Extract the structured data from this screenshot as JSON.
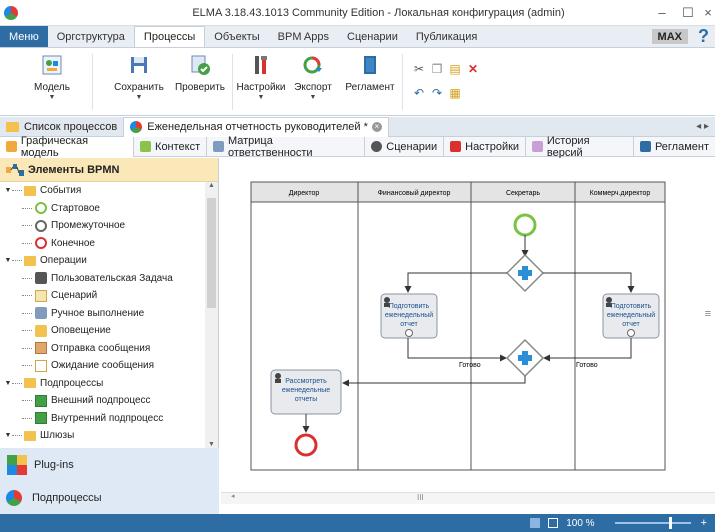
{
  "window": {
    "title": "ELMA 3.18.43.1013 Community Edition - Локальная конфигурация (admin)"
  },
  "menu": {
    "items": [
      "Меню",
      "Оргструктура",
      "Процессы",
      "Объекты",
      "BPM Apps",
      "Сценарии",
      "Публикация"
    ],
    "max_label": "MAX",
    "help": "?"
  },
  "ribbon": {
    "model": "Модель",
    "save": "Сохранить",
    "check": "Проверить",
    "settings": "Настройки",
    "export": "Экспорт",
    "reglament": "Регламент"
  },
  "doc_tabs": {
    "list": "Список процессов",
    "current": "Еженедельная отчетность руководителей *"
  },
  "sub_tabs": [
    "Графическая модель",
    "Контекст",
    "Матрица ответственности",
    "Сценарии",
    "Настройки",
    "История версий",
    "Регламент"
  ],
  "panel": {
    "title": "Элементы BPMN",
    "tree": [
      {
        "label": "События",
        "level": 0,
        "type": "folder"
      },
      {
        "label": "Стартовое",
        "level": 1,
        "type": "start"
      },
      {
        "label": "Промежуточное",
        "level": 1,
        "type": "intermediate"
      },
      {
        "label": "Конечное",
        "level": 1,
        "type": "end"
      },
      {
        "label": "Операции",
        "level": 0,
        "type": "folder"
      },
      {
        "label": "Пользовательская Задача",
        "level": 1,
        "type": "user"
      },
      {
        "label": "Сценарий",
        "level": 1,
        "type": "script"
      },
      {
        "label": "Ручное выполнение",
        "level": 1,
        "type": "manual"
      },
      {
        "label": "Оповещение",
        "level": 1,
        "type": "notify"
      },
      {
        "label": "Отправка сообщения",
        "level": 1,
        "type": "send"
      },
      {
        "label": "Ожидание сообщения",
        "level": 1,
        "type": "wait"
      },
      {
        "label": "Подпроцессы",
        "level": 0,
        "type": "folder"
      },
      {
        "label": "Внешний подпроцесс",
        "level": 1,
        "type": "subproc"
      },
      {
        "label": "Внутренний подпроцесс",
        "level": 1,
        "type": "subproc"
      },
      {
        "label": "Шлюзы",
        "level": 0,
        "type": "folder"
      }
    ],
    "accordion": [
      "Plug-ins",
      "Подпроцессы"
    ]
  },
  "diagram": {
    "lanes": [
      "Директор",
      "Финансовый директор",
      "Секретарь",
      "Коммерч.директор"
    ],
    "task_left": "Подготовить еженедельный отчет",
    "task_right": "Подготовить еженедельный отчет",
    "task_review": "Рассмотреть еженедельные отчеты",
    "flow_label_left": "Готово",
    "flow_label_right": "Готово"
  },
  "status": {
    "zoom": "100 %"
  },
  "colors": {
    "accent": "#2e6da4",
    "start": "#7cc242",
    "end": "#d93030",
    "gateway": "#2a8fd6"
  }
}
